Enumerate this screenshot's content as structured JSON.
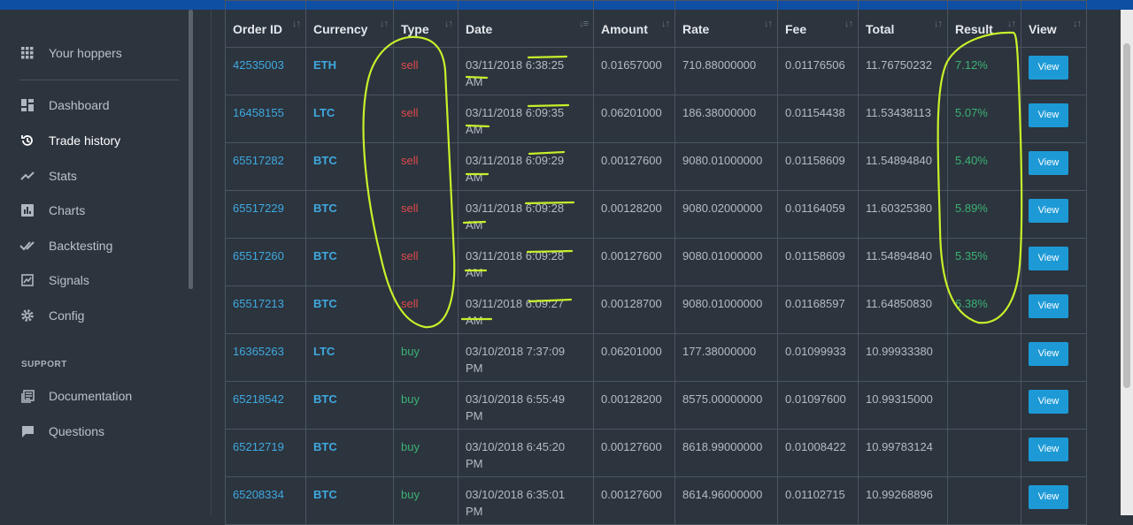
{
  "sidebar": {
    "items": [
      {
        "label": "Your hoppers",
        "icon": "grid-icon"
      },
      {
        "label": "Dashboard",
        "icon": "dashboard-icon"
      },
      {
        "label": "Trade history",
        "icon": "history-icon",
        "active": true
      },
      {
        "label": "Stats",
        "icon": "trend-icon"
      },
      {
        "label": "Charts",
        "icon": "bar-chart-icon"
      },
      {
        "label": "Backtesting",
        "icon": "check-double-icon"
      },
      {
        "label": "Signals",
        "icon": "signal-icon"
      },
      {
        "label": "Config",
        "icon": "gear-icon"
      }
    ],
    "support_heading": "SUPPORT",
    "support_items": [
      {
        "label": "Documentation",
        "icon": "document-icon"
      },
      {
        "label": "Questions",
        "icon": "chat-icon"
      }
    ]
  },
  "table": {
    "headers": [
      "Order ID",
      "Currency",
      "Type",
      "Date",
      "Amount",
      "Rate",
      "Fee",
      "Total",
      "Result",
      "View"
    ],
    "view_label": "View",
    "rows": [
      {
        "order_id": "42535003",
        "currency": "ETH",
        "type": "sell",
        "date": "03/11/2018 6:38:25",
        "ampm": "AM",
        "amount": "0.01657000",
        "rate": "710.88000000",
        "fee": "0.01176506",
        "total": "11.76750232",
        "result": "7.12%"
      },
      {
        "order_id": "16458155",
        "currency": "LTC",
        "type": "sell",
        "date": "03/11/2018 6:09:35",
        "ampm": "AM",
        "amount": "0.06201000",
        "rate": "186.38000000",
        "fee": "0.01154438",
        "total": "11.53438113",
        "result": "5.07%"
      },
      {
        "order_id": "65517282",
        "currency": "BTC",
        "type": "sell",
        "date": "03/11/2018 6:09:29",
        "ampm": "AM",
        "amount": "0.00127600",
        "rate": "9080.01000000",
        "fee": "0.01158609",
        "total": "11.54894840",
        "result": "5.40%"
      },
      {
        "order_id": "65517229",
        "currency": "BTC",
        "type": "sell",
        "date": "03/11/2018 6:09:28",
        "ampm": "AM",
        "amount": "0.00128200",
        "rate": "9080.02000000",
        "fee": "0.01164059",
        "total": "11.60325380",
        "result": "5.89%"
      },
      {
        "order_id": "65517260",
        "currency": "BTC",
        "type": "sell",
        "date": "03/11/2018 6:09:28",
        "ampm": "AM",
        "amount": "0.00127600",
        "rate": "9080.01000000",
        "fee": "0.01158609",
        "total": "11.54894840",
        "result": "5.35%"
      },
      {
        "order_id": "65517213",
        "currency": "BTC",
        "type": "sell",
        "date": "03/11/2018 6:09:27",
        "ampm": "AM",
        "amount": "0.00128700",
        "rate": "9080.01000000",
        "fee": "0.01168597",
        "total": "11.64850830",
        "result": "6.38%"
      },
      {
        "order_id": "16365263",
        "currency": "LTC",
        "type": "buy",
        "date": "03/10/2018 7:37:09",
        "ampm": "PM",
        "amount": "0.06201000",
        "rate": "177.38000000",
        "fee": "0.01099933",
        "total": "10.99933380",
        "result": ""
      },
      {
        "order_id": "65218542",
        "currency": "BTC",
        "type": "buy",
        "date": "03/10/2018 6:55:49",
        "ampm": "PM",
        "amount": "0.00128200",
        "rate": "8575.00000000",
        "fee": "0.01097600",
        "total": "10.99315000",
        "result": ""
      },
      {
        "order_id": "65212719",
        "currency": "BTC",
        "type": "buy",
        "date": "03/10/2018 6:45:20",
        "ampm": "PM",
        "amount": "0.00127600",
        "rate": "8618.99000000",
        "fee": "0.01008422",
        "total": "10.99783124",
        "result": ""
      },
      {
        "order_id": "65208334",
        "currency": "BTC",
        "type": "buy",
        "date": "03/10/2018 6:35:01",
        "ampm": "PM",
        "amount": "0.00127600",
        "rate": "8614.96000000",
        "fee": "0.01102715",
        "total": "10.99268896",
        "result": ""
      }
    ]
  },
  "colors": {
    "accent": "#3fa9e0",
    "sell": "#e04a4a",
    "buy": "#3bb273",
    "button": "#1d9ad6",
    "annotation": "#c8f02a"
  }
}
